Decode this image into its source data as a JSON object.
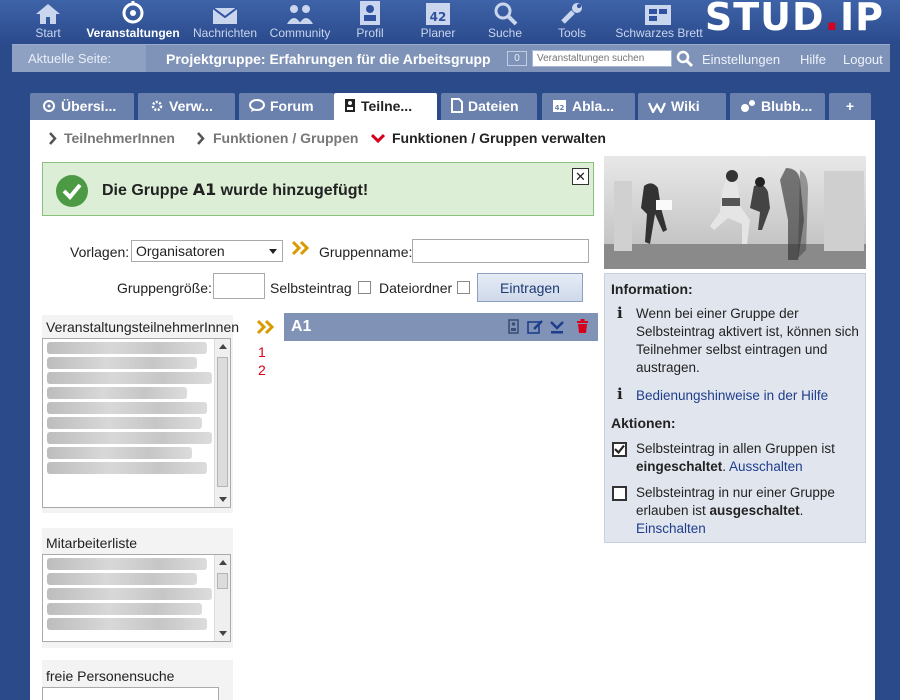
{
  "nav": {
    "items": [
      {
        "label": "Start",
        "icon": "home-icon"
      },
      {
        "label": "Veranstaltungen",
        "icon": "seminar-icon",
        "active": true
      },
      {
        "label": "Nachrichten",
        "icon": "mail-icon"
      },
      {
        "label": "Community",
        "icon": "community-icon"
      },
      {
        "label": "Profil",
        "icon": "profile-icon"
      },
      {
        "label": "Planer",
        "icon": "calendar-icon"
      },
      {
        "label": "Suche",
        "icon": "search-icon"
      },
      {
        "label": "Tools",
        "icon": "tools-icon"
      },
      {
        "label": "Schwarzes Brett",
        "icon": "board-icon"
      }
    ],
    "logo_main": "STUD",
    "logo_dot": ".",
    "logo_end": "IP"
  },
  "location": {
    "label": "Aktuelle Seite:",
    "title": "Projektgruppe: Erfahrungen für die Arbeitsgrupp",
    "count": "0",
    "search_placeholder": "Veranstaltungen suchen",
    "links": [
      "Einstellungen",
      "Hilfe",
      "Logout"
    ]
  },
  "tabs": [
    {
      "label": "Übersi...",
      "icon": "overview-icon"
    },
    {
      "label": "Verw...",
      "icon": "admin-icon"
    },
    {
      "label": "Forum",
      "icon": "forum-icon"
    },
    {
      "label": "Teilne...",
      "icon": "participants-icon",
      "active": true
    },
    {
      "label": "Dateien",
      "icon": "files-icon"
    },
    {
      "label": "Abla...",
      "icon": "schedule-icon"
    },
    {
      "label": "Wiki",
      "icon": "wiki-icon"
    },
    {
      "label": "Blubb...",
      "icon": "blubber-icon"
    },
    {
      "label": "+",
      "icon": "plus-icon"
    }
  ],
  "breadcrumbs": [
    "TeilnehmerInnen",
    "Funktionen / Gruppen",
    "Funktionen / Gruppen verwalten"
  ],
  "message": {
    "prefix": "Die Gruppe ",
    "group": "A1",
    "suffix": " wurde hinzugefügt!"
  },
  "form": {
    "vorlagen_label": "Vorlagen:",
    "vorlagen_value": "Organisatoren",
    "gruppenname_label": "Gruppenname:",
    "gruppengroesse_label": "Gruppengröße:",
    "selbsteintrag_label": "Selbsteintrag",
    "dateiordner_label": "Dateiordner",
    "submit_label": "Eintragen"
  },
  "lists": {
    "participants_label": "VeranstaltungsteilnehmerInnen",
    "staff_label": "Mitarbeiterliste",
    "search_label": "freie Personensuche"
  },
  "group": {
    "name": "A1",
    "numbers": [
      "1",
      "2"
    ]
  },
  "sidebar": {
    "info_heading": "Information:",
    "info_text": "Wenn bei einer Gruppe der Selbsteintrag aktivert ist, können sich Teilnehmer selbst eintragen und austragen.",
    "help_link": "Bedienungshinweise in der Hilfe",
    "actions_heading": "Aktionen:",
    "action1_text": "Selbsteintrag in allen Gruppen ist ",
    "action1_bold": "eingeschaltet",
    "action1_after": ". ",
    "action1_link": "Ausschalten",
    "action2_text": "Selbsteintrag in nur einer Gruppe erlauben ist ",
    "action2_bold": "ausgeschaltet",
    "action2_after": ".",
    "action2_link": "Einschalten"
  },
  "colors": {
    "nav_bg": "#2b4a8a",
    "success_bg": "#dcefd6",
    "success_icon": "#4d9a45",
    "group_header": "#8093b6",
    "accent_red": "#d6001c",
    "link": "#1f3d8c"
  }
}
